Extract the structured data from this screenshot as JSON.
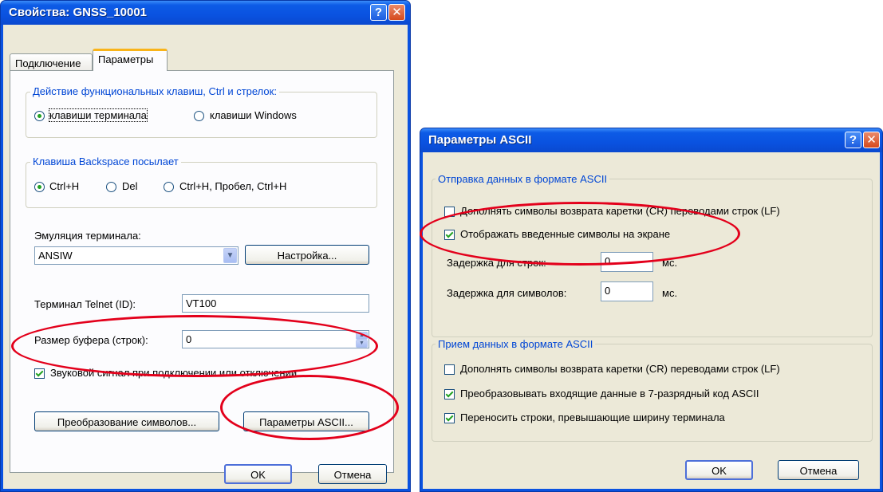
{
  "dialog1": {
    "title": "Свойства: GNSS_10001",
    "help_glyph": "?",
    "close_glyph": "✕",
    "tabs": [
      "Подключение",
      "Параметры"
    ],
    "func_keys": {
      "legend": "Действие функциональных клавиш, Ctrl и стрелок:",
      "options": [
        "клавиши терминала",
        "клавиши Windows"
      ],
      "selected": 0
    },
    "backspace": {
      "legend": "Клавиша  Backspace посылает",
      "options": [
        "Ctrl+H",
        "Del",
        "Ctrl+H, Пробел, Ctrl+H"
      ],
      "selected": 0
    },
    "emulation": {
      "label": "Эмуляция терминала:",
      "value": "ANSIW",
      "setup_button": "Настройка..."
    },
    "telnet": {
      "label": "Терминал Telnet (ID):",
      "value": "VT100"
    },
    "buffer": {
      "label": "Размер буфера (строк):",
      "value": "0"
    },
    "beep": {
      "label": "Звуковой сигнал при подключении или отключении",
      "checked": true
    },
    "char_convert_button": "Преобразование символов...",
    "ascii_button": "Параметры ASCII...",
    "ok": "OK",
    "cancel": "Отмена"
  },
  "dialog2": {
    "title": "Параметры ASCII",
    "help_glyph": "?",
    "close_glyph": "✕",
    "send": {
      "legend": "Отправка данных в формате ASCII",
      "append_lf": {
        "label": "Дополнять символы возврата каретки (CR) переводами строк (LF)",
        "checked": false
      },
      "echo": {
        "label": "Отображать введенные символы на экране",
        "checked": true
      },
      "line_delay": {
        "label": "Задержка для строк:",
        "value": "0",
        "unit": "мс."
      },
      "char_delay": {
        "label": "Задержка для символов:",
        "value": "0",
        "unit": "мс."
      }
    },
    "receive": {
      "legend": "Прием данных в формате ASCII",
      "append_lf": {
        "label": "Дополнять символы возврата каретки (CR) переводами строк (LF)",
        "checked": false
      },
      "to_7bit": {
        "label": "Преобразовывать входящие данные в 7-разрядный код ASCII",
        "checked": true
      },
      "wrap": {
        "label": "Переносить строки, превышающие ширину терминала",
        "checked": true
      }
    },
    "ok": "OK",
    "cancel": "Отмена"
  },
  "colors": {
    "highlight_ellipse": "#e3001b",
    "xp_title_blue": "#0a52e0",
    "dialog_face": "#ece9d8"
  },
  "icons": {
    "help": "help-icon",
    "close": "close-icon",
    "dropdown": "chevron-down-icon",
    "spinner": "spinner-arrows-icon"
  }
}
